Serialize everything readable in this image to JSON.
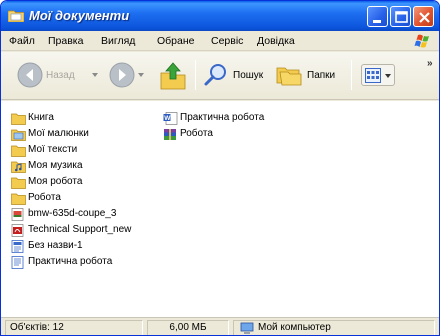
{
  "window": {
    "title": "Мої документи"
  },
  "menu": {
    "items": [
      "Файл",
      "Правка",
      "Вигляд",
      "Обране",
      "Сервіс",
      "Довідка"
    ]
  },
  "toolbar": {
    "back_label": "Назад",
    "search_label": "Пошук",
    "folders_label": "Папки",
    "more": "»"
  },
  "files": [
    {
      "name": "Книга",
      "icon": "folder-icon"
    },
    {
      "name": "Мої малюнки",
      "icon": "pictures-folder-icon"
    },
    {
      "name": "Мої тексти",
      "icon": "folder-icon"
    },
    {
      "name": "Моя музика",
      "icon": "music-folder-icon"
    },
    {
      "name": "Моя робота",
      "icon": "folder-icon"
    },
    {
      "name": "Робота",
      "icon": "folder-icon"
    },
    {
      "name": "bmw-635d-coupe_3",
      "icon": "image-file-icon"
    },
    {
      "name": "Technical Support_new",
      "icon": "pdf-file-icon"
    },
    {
      "name": "Без назви-1",
      "icon": "document-file-icon"
    },
    {
      "name": "Практична робота",
      "icon": "document-file-icon"
    },
    {
      "name": "Практична робота",
      "icon": "word-file-icon"
    },
    {
      "name": "Робота",
      "icon": "archive-file-icon"
    }
  ],
  "status": {
    "objects": "Об'єктів: 12",
    "size": "6,00 МБ",
    "location": "Мой компьютер"
  },
  "colors": {
    "titlebar": "#0c55dc",
    "folder": "#f2c94c",
    "close_button": "#e1532f"
  }
}
